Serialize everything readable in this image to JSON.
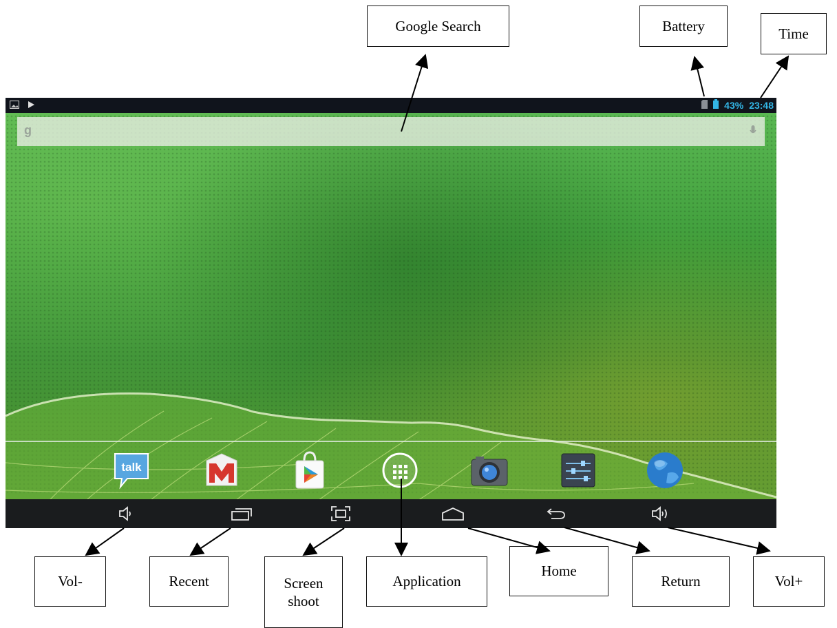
{
  "status_bar": {
    "battery_percent": "43%",
    "time": "23:48",
    "accent_color": "#33b5e5",
    "left_icons": [
      "picture-icon",
      "play-icon"
    ]
  },
  "search_bar": {
    "google_glyph": "g",
    "mic_icon": "microphone-icon"
  },
  "dock": {
    "talk_label": "talk",
    "apps": [
      "talk-icon",
      "gmail-icon",
      "play-store-icon",
      "app-drawer-icon",
      "camera-icon",
      "settings-icon",
      "browser-globe-icon"
    ]
  },
  "navigation_bar": {
    "buttons": [
      "volume-down-icon",
      "recent-apps-icon",
      "screenshot-icon",
      "home-icon",
      "back-icon",
      "volume-up-icon"
    ]
  },
  "callouts": {
    "google_search": "Google Search",
    "battery": "Battery",
    "time": "Time",
    "vol_minus": "Vol-",
    "recent": "Recent",
    "screen_shoot": "Screen\nshoot",
    "application": "Application",
    "home": "Home",
    "return": "Return",
    "vol_plus": "Vol+"
  }
}
